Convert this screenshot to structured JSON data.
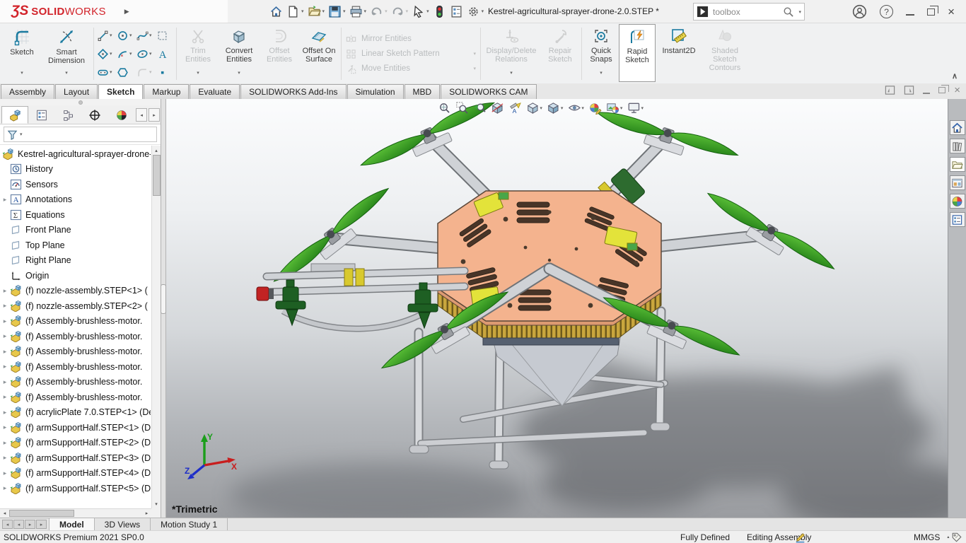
{
  "colors": {
    "sw-red": "#d2232a",
    "accent-blue": "#1b7ba0",
    "ribbon-orange": "#f59a23",
    "prop-green": "#2f9e23",
    "plate-salmon": "#f2b28c",
    "viewport-top": "#fbfcfd",
    "viewport-bottom": "#9a9ca0"
  },
  "titlebar": {
    "logo_mark": "ƷS",
    "logo_bold": "SOLID",
    "logo_light": "WORKS",
    "title": "Kestrel-agricultural-sprayer-drone-2.0.STEP *",
    "search_value": "toolbox",
    "quick_access_icons": [
      "home",
      "new-document",
      "open",
      "save",
      "print",
      "undo",
      "redo",
      "select",
      "rebuild",
      "file-properties",
      "options"
    ]
  },
  "ribbon": {
    "buttons": {
      "sketch": "Sketch",
      "smart_dimension": "Smart Dimension",
      "trim": "Trim Entities",
      "convert": "Convert Entities",
      "offset": "Offset Entities",
      "offset_surface": "Offset On Surface",
      "mirror": "Mirror Entities",
      "linear_pattern": "Linear Sketch Pattern",
      "move": "Move Entities",
      "display_delete": "Display/Delete Relations",
      "repair": "Repair Sketch",
      "quick_snaps": "Quick Snaps",
      "rapid_sketch": "Rapid Sketch",
      "instant2d": "Instant2D",
      "shaded_contours": "Shaded Sketch Contours"
    },
    "sketch_tool_icons": [
      "line",
      "circle",
      "spline",
      "corner-rectangle",
      "polygon",
      "arc",
      "ellipse",
      "text",
      "slot",
      "hexagon",
      "sketch-fillet",
      "point"
    ],
    "tabs": [
      {
        "label": "Assembly"
      },
      {
        "label": "Layout"
      },
      {
        "label": "Sketch"
      },
      {
        "label": "Markup"
      },
      {
        "label": "Evaluate"
      },
      {
        "label": "SOLIDWORKS Add-Ins"
      },
      {
        "label": "Simulation"
      },
      {
        "label": "MBD"
      },
      {
        "label": "SOLIDWORKS CAM"
      }
    ]
  },
  "feature_tree": {
    "root": "Kestrel-agricultural-sprayer-drone-",
    "manager_tab_icons": [
      "featuremanager",
      "propertymanager",
      "configurationmanager",
      "dimxpertmanager",
      "displaymanager"
    ],
    "items": [
      {
        "icon": "history",
        "label": "History"
      },
      {
        "icon": "sensors",
        "label": "Sensors"
      },
      {
        "icon": "annotations",
        "label": "Annotations"
      },
      {
        "icon": "equations",
        "label": "Equations"
      },
      {
        "icon": "plane",
        "label": "Front Plane"
      },
      {
        "icon": "plane",
        "label": "Top Plane"
      },
      {
        "icon": "plane",
        "label": "Right Plane"
      },
      {
        "icon": "origin",
        "label": "Origin"
      },
      {
        "icon": "assembly",
        "label": "(f) nozzle-assembly.STEP<1> ("
      },
      {
        "icon": "assembly",
        "label": "(f) nozzle-assembly.STEP<2> ("
      },
      {
        "icon": "assembly",
        "label": "(f) Assembly-brushless-motor."
      },
      {
        "icon": "assembly",
        "label": "(f) Assembly-brushless-motor."
      },
      {
        "icon": "assembly",
        "label": "(f) Assembly-brushless-motor."
      },
      {
        "icon": "assembly",
        "label": "(f) Assembly-brushless-motor."
      },
      {
        "icon": "assembly",
        "label": "(f) Assembly-brushless-motor."
      },
      {
        "icon": "assembly",
        "label": "(f) Assembly-brushless-motor."
      },
      {
        "icon": "assembly",
        "label": "(f) acrylicPlate 7.0.STEP<1> (De"
      },
      {
        "icon": "assembly",
        "label": "(f) armSupportHalf.STEP<1> (D"
      },
      {
        "icon": "assembly",
        "label": "(f) armSupportHalf.STEP<2> (D"
      },
      {
        "icon": "assembly",
        "label": "(f) armSupportHalf.STEP<3> (D"
      },
      {
        "icon": "assembly",
        "label": "(f) armSupportHalf.STEP<4> (D"
      },
      {
        "icon": "assembly",
        "label": "(f) armSupportHalf.STEP<5> (D"
      }
    ]
  },
  "viewport": {
    "orientation_label": "*Trimetric",
    "triad": {
      "x": "X",
      "y": "Y",
      "z": "Z"
    },
    "headsup_icons": [
      "zoom-to-fit",
      "zoom-to-area",
      "previous-view",
      "section-view",
      "dynamic-annotation-views",
      "view-orientation",
      "display-style",
      "hide-show-items",
      "edit-appearance",
      "apply-scene",
      "view-settings"
    ]
  },
  "task_pane_icons": [
    "home",
    "design-library",
    "file-explorer",
    "view-palette",
    "appearances-scenes",
    "custom-properties"
  ],
  "document_tabs": {
    "tabs": [
      {
        "label": "Model"
      },
      {
        "label": "3D Views"
      },
      {
        "label": "Motion Study 1"
      }
    ]
  },
  "status_bar": {
    "product": "SOLIDWORKS Premium 2021 SP0.0",
    "state": "Fully Defined",
    "mode": "Editing Assembly",
    "units": "MMGS"
  }
}
